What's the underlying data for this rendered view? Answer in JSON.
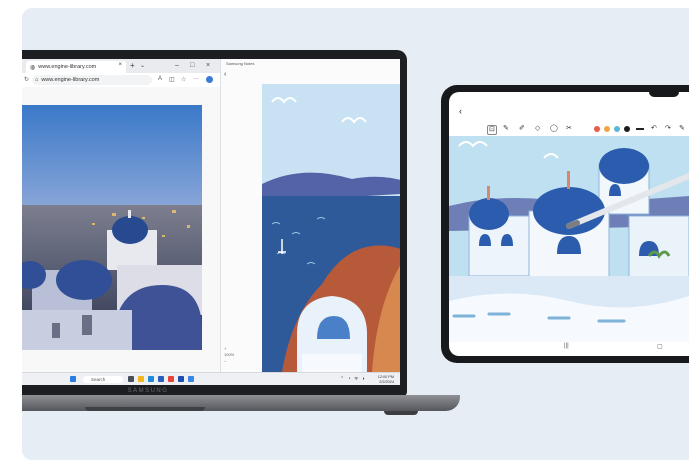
{
  "laptop": {
    "brand": "SAMSUNG",
    "browser": {
      "tab_title": "www.engine-library.com",
      "tab_close": "×",
      "new_tab": "+",
      "tab_menu": "⌄",
      "window_controls": [
        "–",
        "□",
        "×"
      ],
      "url": "www.engine-library.com"
    },
    "notes_app": {
      "title": "Samsung Notes",
      "back": "‹",
      "zoom": [
        "+",
        "100%",
        "–"
      ]
    },
    "taskbar": {
      "search_placeholder": "Search",
      "time": "12:00 PM",
      "date": "2/2/2024"
    }
  },
  "tablet": {
    "back": "‹",
    "pen_colors": [
      "#e55c4a",
      "#f0a640",
      "#5bb8d1",
      "#1d1d1d"
    ]
  },
  "colors": {
    "background": "#e7edf5",
    "laptop_bezel": "#1d1e21",
    "accent_blue": "#2b5cad"
  }
}
